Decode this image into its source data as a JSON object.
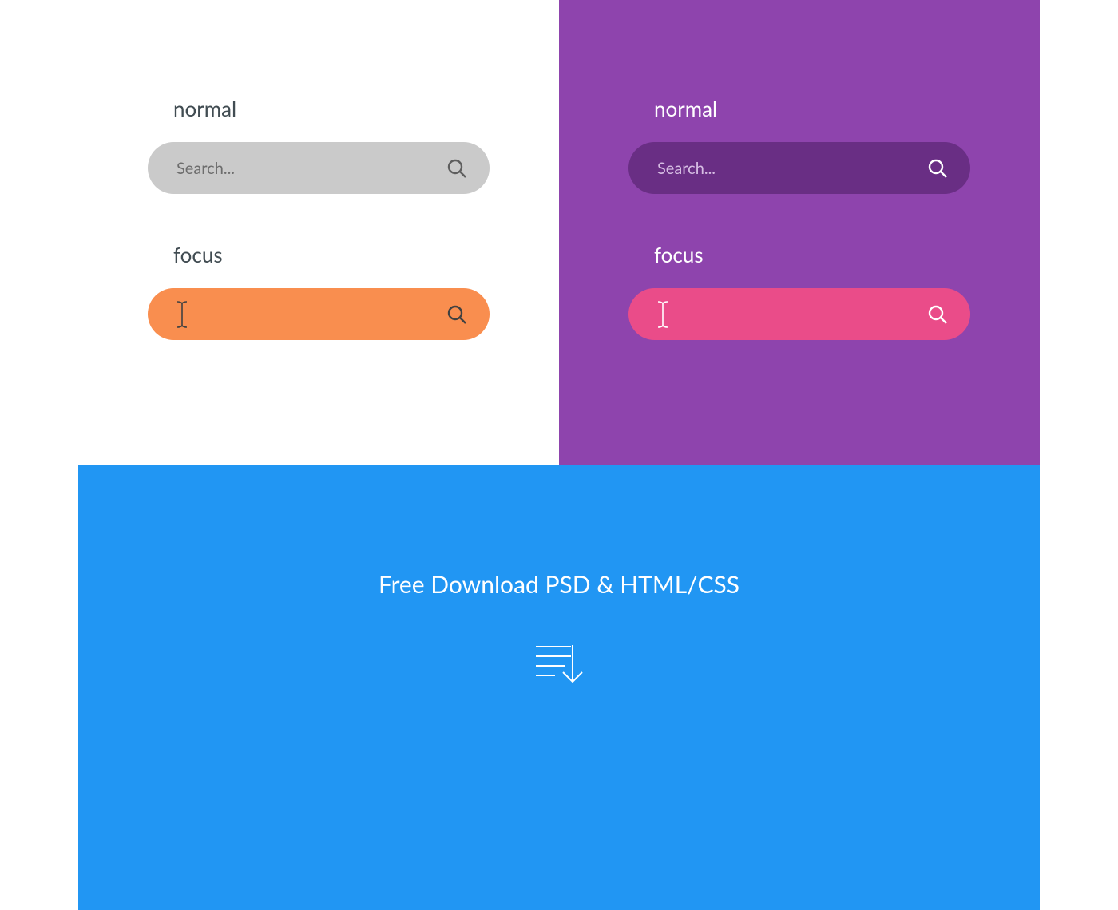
{
  "light": {
    "normal_label": "normal",
    "focus_label": "focus",
    "placeholder": "Search...",
    "normal_bg": "#cacaca",
    "focus_bg": "#f98e4f"
  },
  "dark": {
    "normal_label": "normal",
    "focus_label": "focus",
    "placeholder": "Search...",
    "panel_bg": "#8e44ad",
    "normal_bg": "#692e84",
    "focus_bg": "#ea4c89"
  },
  "download": {
    "title": "Free Download PSD & HTML/CSS",
    "panel_bg": "#2196f3"
  }
}
